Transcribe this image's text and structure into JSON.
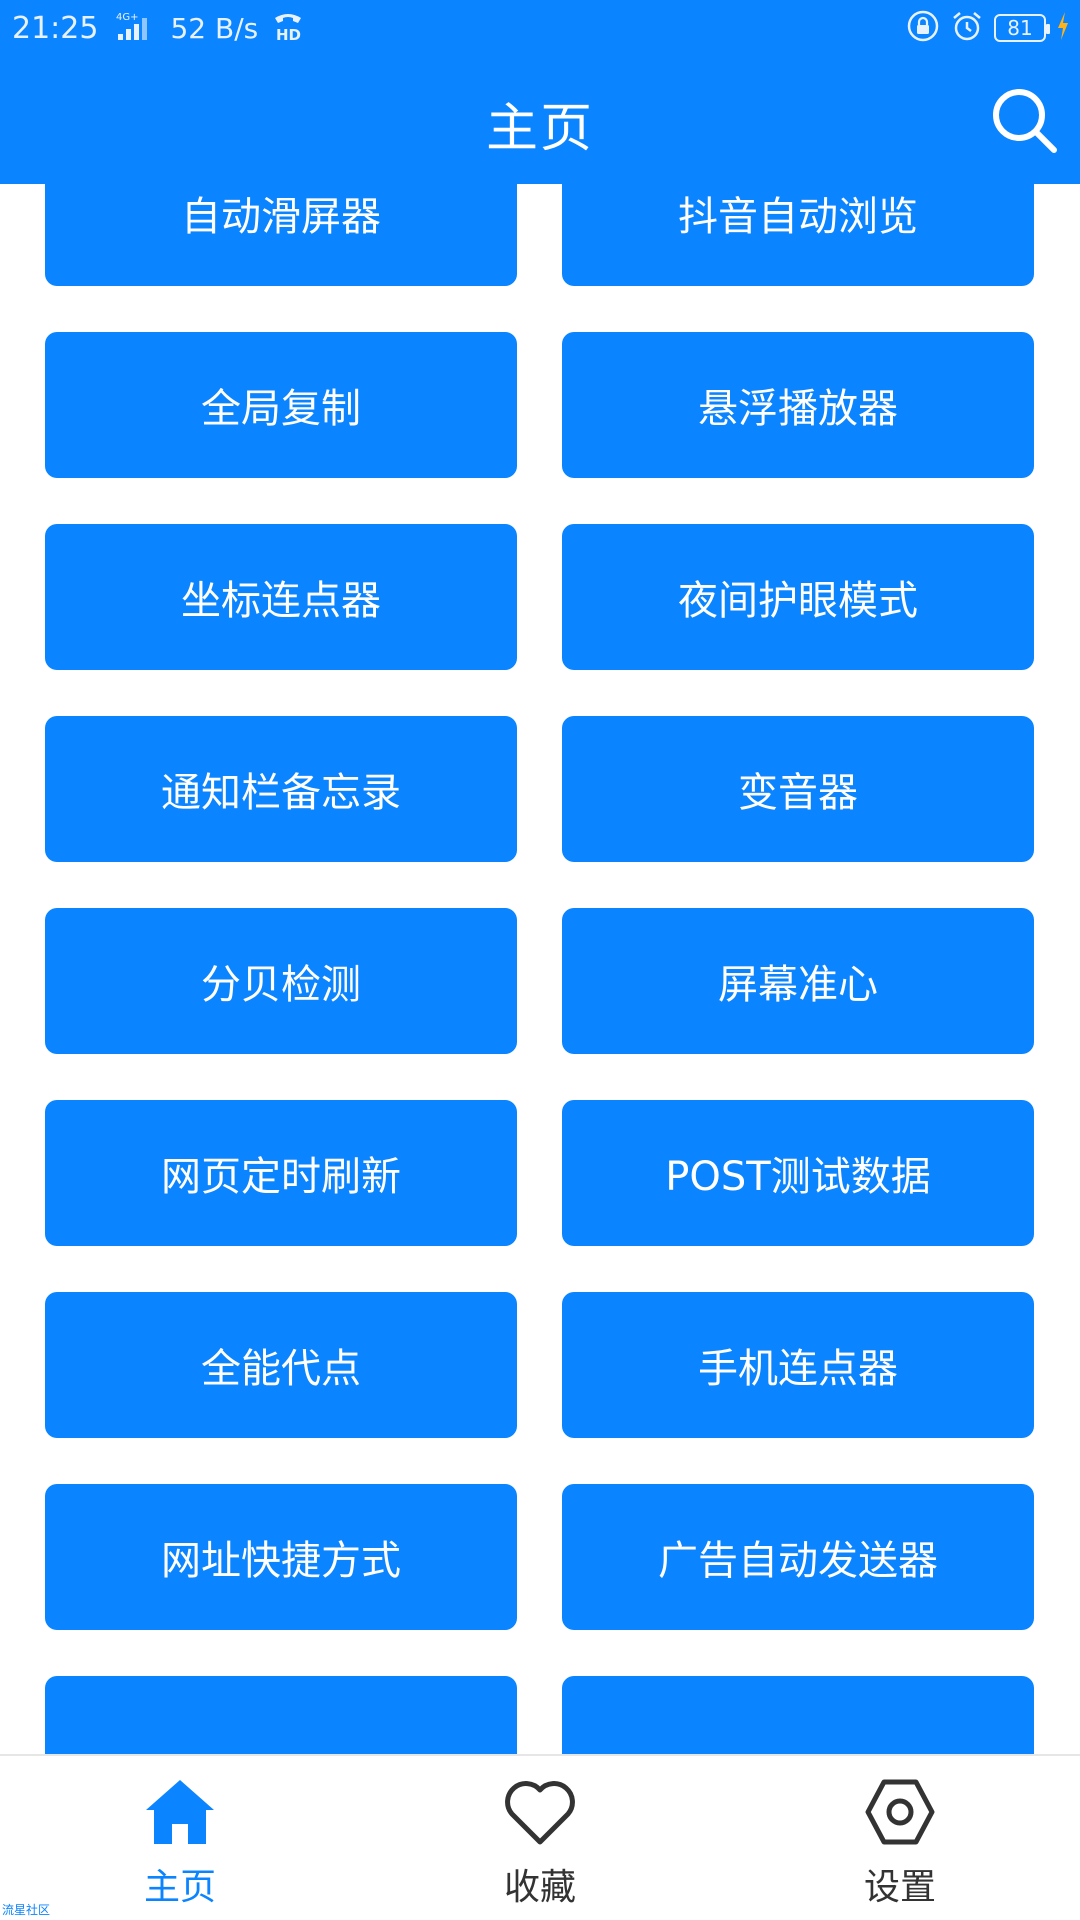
{
  "status_bar": {
    "time": "21:25",
    "network": "4G+",
    "speed": "52 B/s",
    "hd": "HD",
    "battery": "81"
  },
  "header": {
    "title": "主页"
  },
  "grid": {
    "items": [
      {
        "label": "自动滑屏器"
      },
      {
        "label": "抖音自动浏览"
      },
      {
        "label": "全局复制"
      },
      {
        "label": "悬浮播放器"
      },
      {
        "label": "坐标连点器"
      },
      {
        "label": "夜间护眼模式"
      },
      {
        "label": "通知栏备忘录"
      },
      {
        "label": "变音器"
      },
      {
        "label": "分贝检测"
      },
      {
        "label": "屏幕准心"
      },
      {
        "label": "网页定时刷新"
      },
      {
        "label": "POST测试数据"
      },
      {
        "label": "全能代点"
      },
      {
        "label": "手机连点器"
      },
      {
        "label": "网址快捷方式"
      },
      {
        "label": "广告自动发送器"
      },
      {
        "label": ""
      },
      {
        "label": ""
      }
    ]
  },
  "bottom_nav": {
    "home": "主页",
    "favorites": "收藏",
    "settings": "设置",
    "active": "home"
  },
  "watermark": "流星社区",
  "colors": {
    "primary": "#0b84ff",
    "nav_inactive": "#333333"
  }
}
